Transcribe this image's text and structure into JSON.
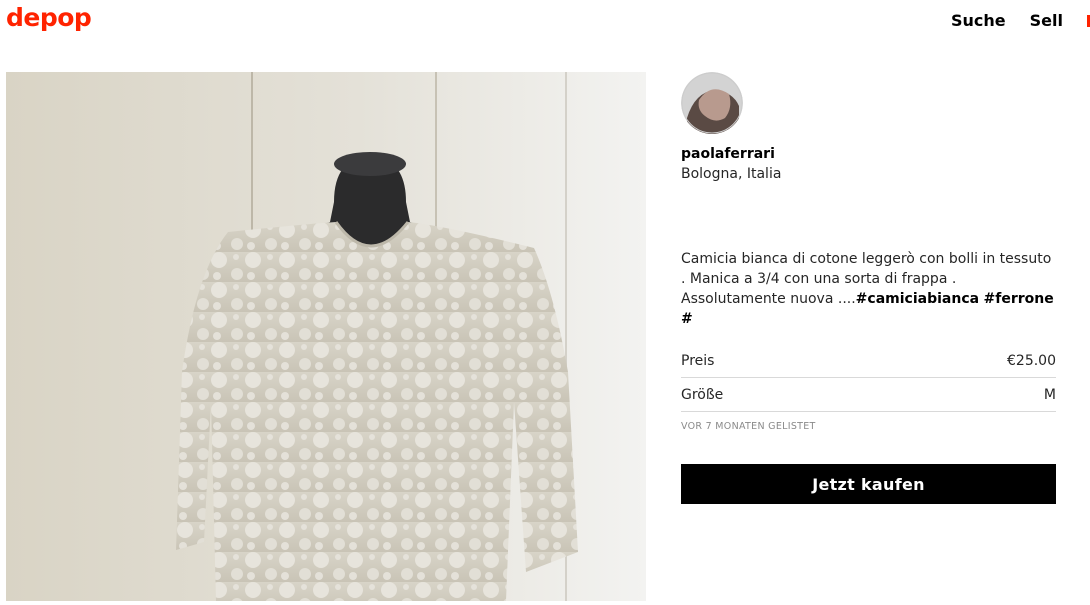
{
  "header": {
    "logo": "depop",
    "nav": {
      "search": "Suche",
      "sell": "Sell"
    },
    "accent_color": "#ff2300"
  },
  "seller": {
    "username": "paolaferrari",
    "location": "Bologna, Italia"
  },
  "listing": {
    "description_text": "Camicia bianca di cotone leggerò con bolli in tessuto . Manica a 3/4 con una sorta di frappa . Assolutamente nuova ....",
    "hashtag_1": "#camiciabianca",
    "hashtag_2": "#ferrone",
    "hashtag_3": "#",
    "price_label": "Preis",
    "price_value": "€25.00",
    "size_label": "Größe",
    "size_value": "M",
    "listed_ago": "VOR 7 MONATEN GELISTET",
    "buy_button": "Jetzt kaufen"
  }
}
